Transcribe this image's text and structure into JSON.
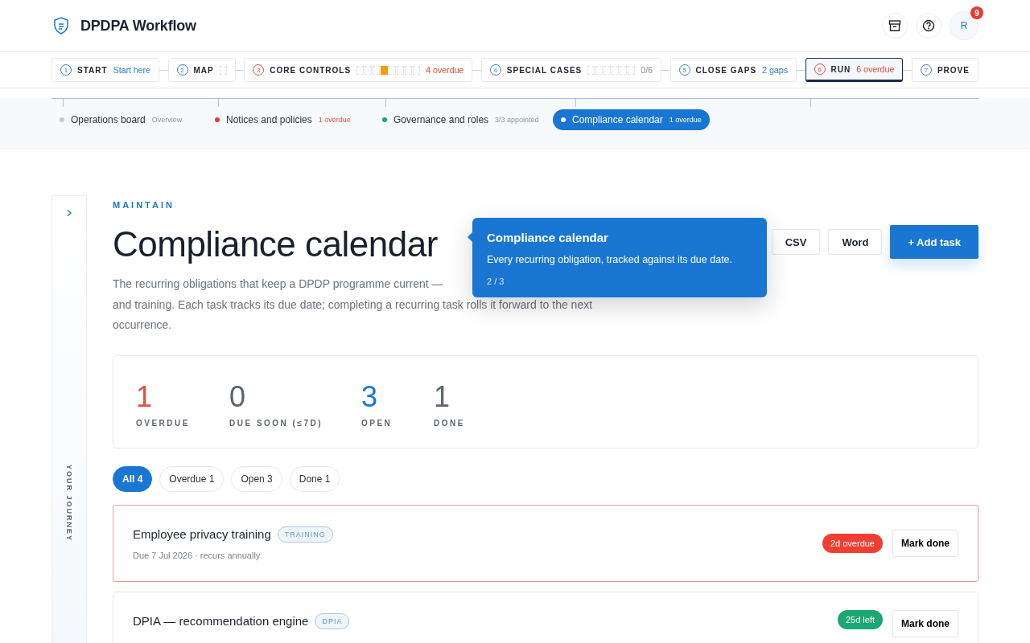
{
  "app": {
    "title": "DPDPA Workflow",
    "notifications": "9",
    "avatar": "R"
  },
  "steps": [
    {
      "number": "1",
      "label": "START",
      "note": "Start here",
      "color": "#3b82c6",
      "alert": false,
      "selected": false
    },
    {
      "number": "2",
      "label": "MAP",
      "alert": false,
      "selected": false,
      "segments": [
        {
          "filled": false
        }
      ]
    },
    {
      "number": "3",
      "label": "CORE CONTROLS",
      "note": "4 overdue",
      "color": "#e0523f",
      "alert": true,
      "selected": false,
      "segments": [
        {
          "filled": false
        },
        {
          "filled": false
        },
        {
          "filled": false
        },
        {
          "filled": true
        },
        {
          "filled": false
        },
        {
          "filled": false
        },
        {
          "filled": false
        },
        {
          "filled": false
        }
      ]
    },
    {
      "number": "4",
      "label": "SPECIAL CASES",
      "note": "0/6",
      "color": "#8a939e",
      "alert": false,
      "selected": false,
      "segments": [
        {
          "filled": false
        },
        {
          "filled": false
        },
        {
          "filled": false
        },
        {
          "filled": false
        },
        {
          "filled": false
        },
        {
          "filled": false
        }
      ]
    },
    {
      "number": "5",
      "label": "CLOSE GAPS",
      "note": "2 gaps",
      "color": "#3b82c6",
      "alert": false,
      "selected": false
    },
    {
      "number": "6",
      "label": "RUN",
      "note": "6 overdue",
      "color": "#e0523f",
      "alert": true,
      "selected": true
    },
    {
      "number": "7",
      "label": "PROVE",
      "alert": false,
      "selected": false
    }
  ],
  "substeps": [
    {
      "label": "Operations board",
      "note": "Overview",
      "color": "#c4c9d0",
      "alert": false,
      "selected": false
    },
    {
      "label": "Notices and policies",
      "note": "1 overdue",
      "color": "#e53935",
      "alert": true,
      "selected": false
    },
    {
      "label": "Governance and roles",
      "note": "3/3 appointed",
      "color": "#1aa774",
      "alert": false,
      "selected": false
    },
    {
      "label": "Compliance calendar",
      "note": "1 overdue",
      "color": "#ffffff",
      "alert": true,
      "selected": true
    }
  ],
  "sidebar": {
    "label": "YOUR JOURNEY"
  },
  "page": {
    "eyebrow": "MAINTAIN",
    "title": "Compliance calendar",
    "description_1": "The recurring obligations that keep a DPDP programme current —",
    "description_2": "and training. Each task tracks its due date; completing a recurring task rolls it forward to the next",
    "description_3": "occurrence."
  },
  "actions": [
    {
      "label": "CSV",
      "kind": "plain"
    },
    {
      "label": "Word",
      "kind": "plain"
    },
    {
      "label": "+ Add task",
      "kind": "primary"
    }
  ],
  "tooltip": {
    "title": "Compliance calendar",
    "text": "Every recurring obligation, tracked against its due date.",
    "step": "2 / 3"
  },
  "stats": [
    {
      "value": "1",
      "label": "OVERDUE",
      "color": "#e0523f"
    },
    {
      "value": "0",
      "label": "DUE SOON (≤7D)",
      "color": "#5b6470"
    },
    {
      "value": "3",
      "label": "OPEN",
      "color": "#1976d2"
    },
    {
      "value": "1",
      "label": "DONE",
      "color": "#5b6470"
    }
  ],
  "filters": [
    {
      "label": "All 4",
      "selected": true
    },
    {
      "label": "Overdue 1",
      "selected": false
    },
    {
      "label": "Open 3",
      "selected": false
    },
    {
      "label": "Done 1",
      "selected": false
    }
  ],
  "tasks": [
    {
      "title": "Employee privacy training",
      "tag": "TRAINING",
      "meta": "Due 7 Jul 2026 · recurs annually",
      "status": "2d overdue",
      "overdue": true,
      "button": "Mark done"
    },
    {
      "title": "DPIA — recommendation engine",
      "tag": "DPIA",
      "status": "25d left",
      "overdue": false,
      "button": "Mark done"
    }
  ]
}
